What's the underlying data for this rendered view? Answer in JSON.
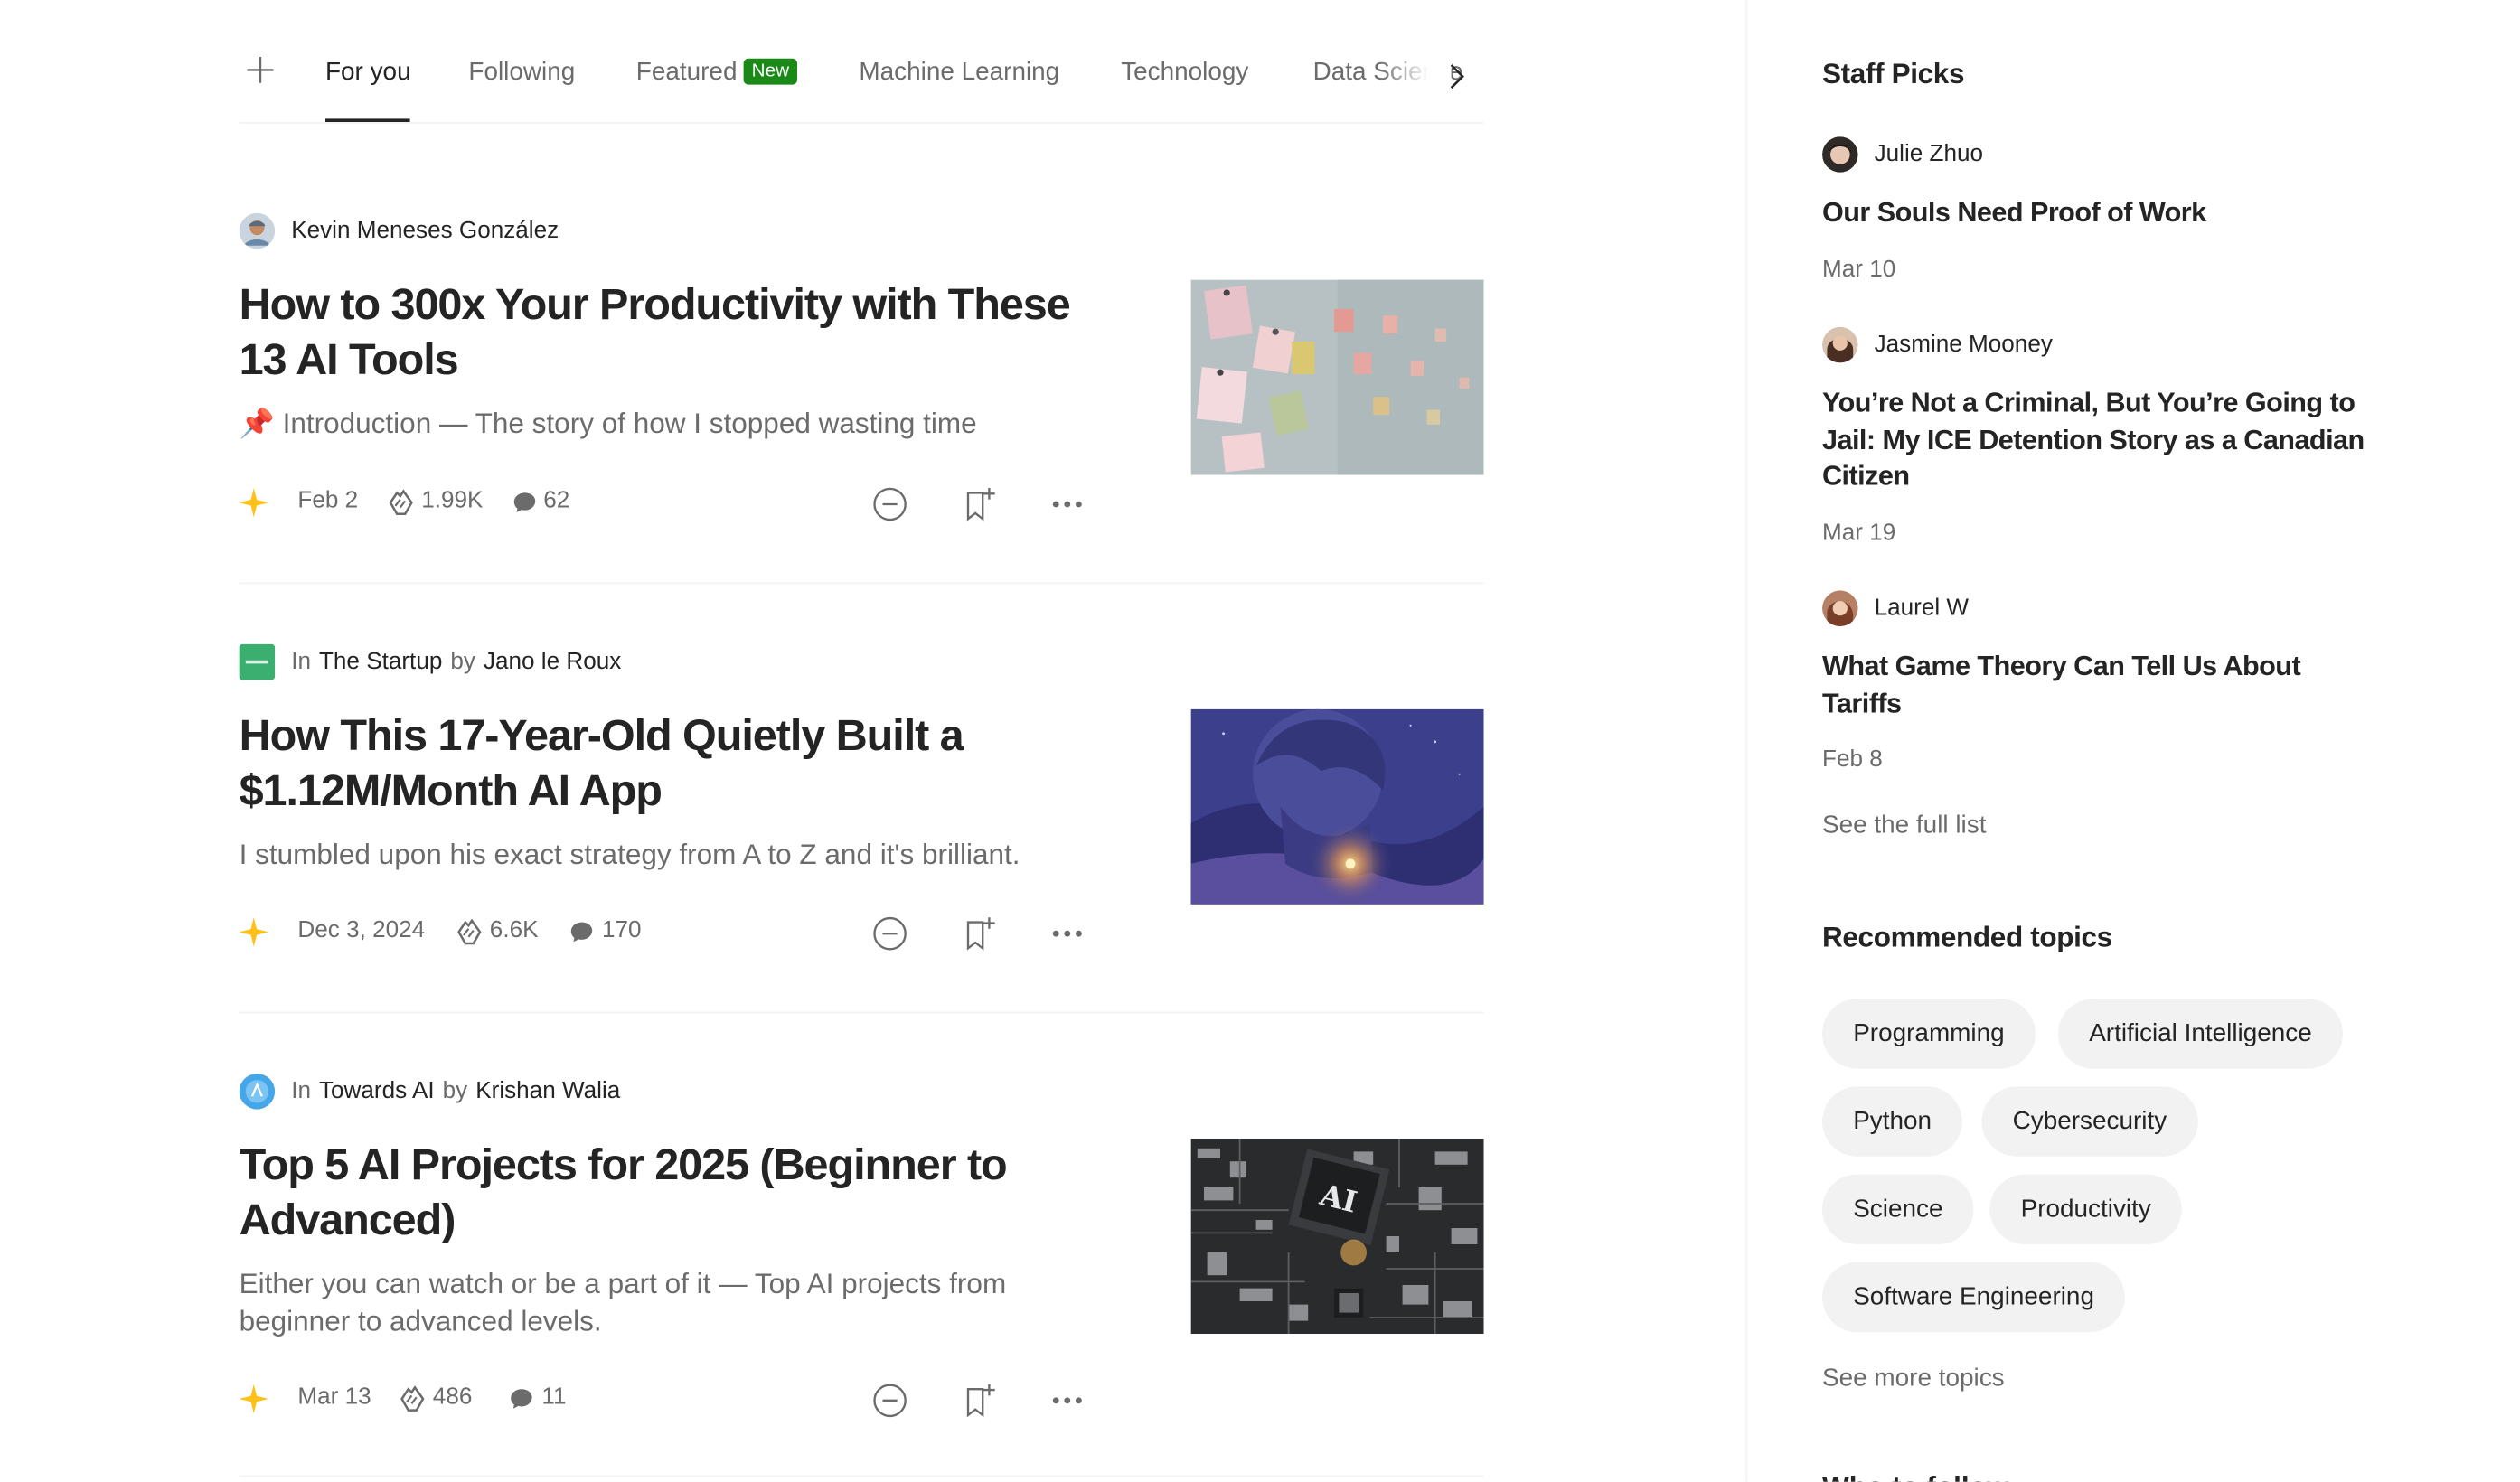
{
  "tabs": {
    "add_label": "+",
    "items": [
      {
        "label": "For you"
      },
      {
        "label": "Following"
      },
      {
        "label": "Featured",
        "badge": "New"
      },
      {
        "label": "Machine Learning"
      },
      {
        "label": "Technology"
      },
      {
        "label": "Data Science"
      }
    ],
    "active_index": 0
  },
  "articles": [
    {
      "author": "Kevin Meneses González",
      "title": "How to 300x Your Productivity with These 13 AI Tools",
      "subtitle_emoji": "📌",
      "subtitle": "Introduction — The story of how I stopped wasting time",
      "date": "Feb 2",
      "claps": "1.99K",
      "responses": "62",
      "thumbnail": "sticky-notes-wall-photo"
    },
    {
      "in_label": "In",
      "publication": "The Startup",
      "by_label": "by",
      "author": "Jano le Roux",
      "title": "How This 17-Year-Old Quietly Built a $1.12M/Month AI App",
      "subtitle": "I stumbled upon his exact strategy from A to Z and it's brilliant.",
      "date": "Dec 3, 2024",
      "claps": "6.6K",
      "responses": "170",
      "thumbnail": "boy-with-glowing-light-illustration"
    },
    {
      "in_label": "In",
      "publication": "Towards AI",
      "by_label": "by",
      "author": "Krishan Walia",
      "title": "Top 5 AI Projects for 2025 (Beginner to Advanced)",
      "subtitle": "Either you can watch or be a part of it — Top AI projects from beginner to advanced levels.",
      "date": "Mar 13",
      "claps": "486",
      "responses": "11",
      "thumbnail": "ai-chip-circuit-board-photo",
      "thumbnail_text": "AI"
    }
  ],
  "sidebar": {
    "staff_picks_title": "Staff Picks",
    "picks": [
      {
        "author": "Julie Zhuo",
        "title": "Our Souls Need Proof of Work",
        "date": "Mar 10"
      },
      {
        "author": "Jasmine Mooney",
        "title": "You’re Not a Criminal, But You’re Going to Jail: My ICE Detention Story as a Canadian Citizen",
        "date": "Mar 19"
      },
      {
        "author": "Laurel W",
        "title": "What Game Theory Can Tell Us About Tariffs",
        "date": "Feb 8"
      }
    ],
    "see_full_list": "See the full list",
    "recommended_title": "Recommended topics",
    "topics": [
      "Programming",
      "Artificial Intelligence",
      "Python",
      "Cybersecurity",
      "Science",
      "Productivity",
      "Software Engineering"
    ],
    "see_more_topics": "See more topics",
    "who_to_follow_title": "Who to follow"
  },
  "colors": {
    "text": "#242424",
    "muted": "#6b6b6b",
    "badge_green": "#1a8917",
    "star_yellow": "#ffc017",
    "chip_bg": "#f2f2f2"
  }
}
